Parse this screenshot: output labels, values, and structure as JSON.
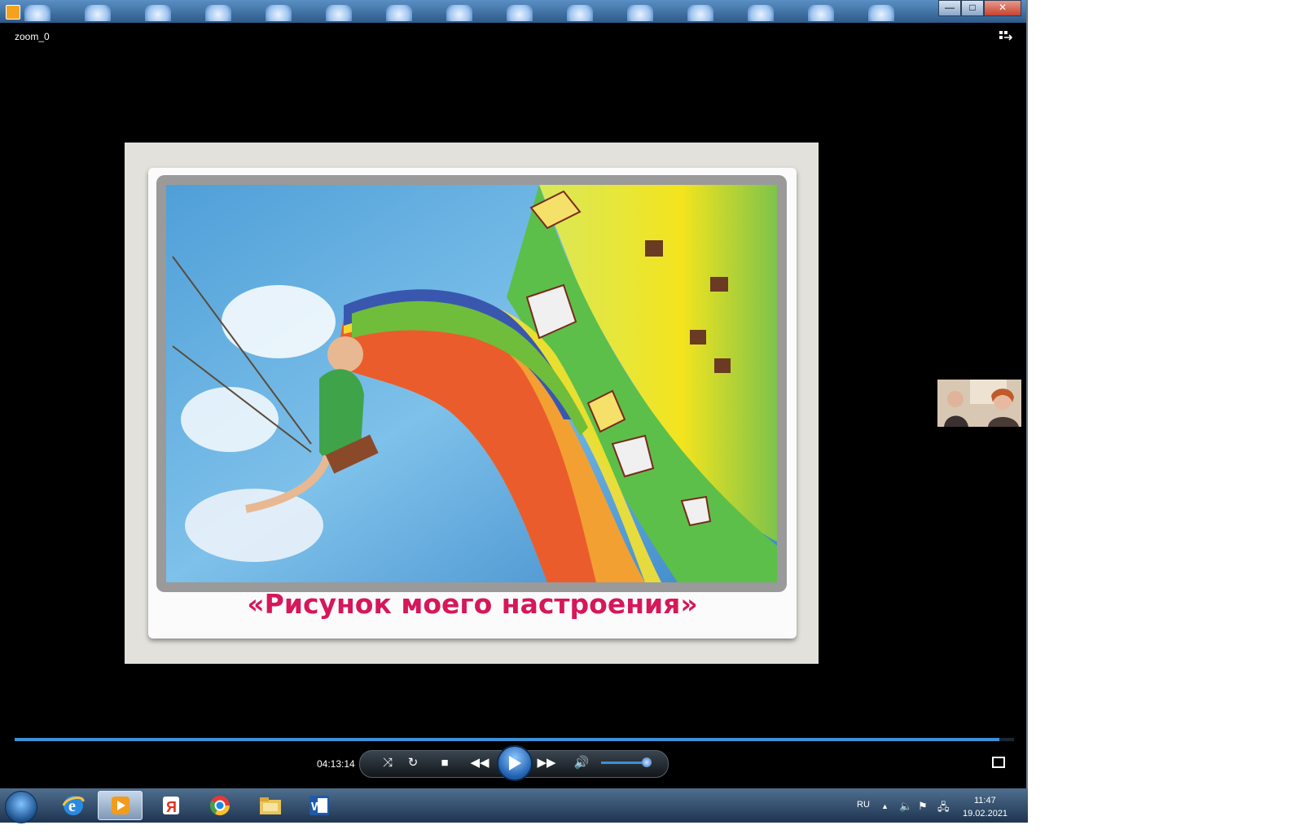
{
  "window": {
    "file_title": "zoom_0",
    "buttons": {
      "minimize": "—",
      "maximize": "□",
      "close": "✕"
    }
  },
  "slide": {
    "caption": "«Рисунок моего настроения»"
  },
  "player": {
    "timecode": "04:13:14",
    "progress": 0.985,
    "volume": 0.9
  },
  "taskbar": {
    "items": [
      "start-orb",
      "ie-icon",
      "media-player-icon",
      "yandex-browser-icon",
      "chrome-icon",
      "file-explorer-icon",
      "word-icon"
    ],
    "language": "RU",
    "time": "11:47",
    "date": "19.02.2021"
  },
  "colors": {
    "caption": "#d6175a",
    "accent": "#3e8fd6"
  }
}
